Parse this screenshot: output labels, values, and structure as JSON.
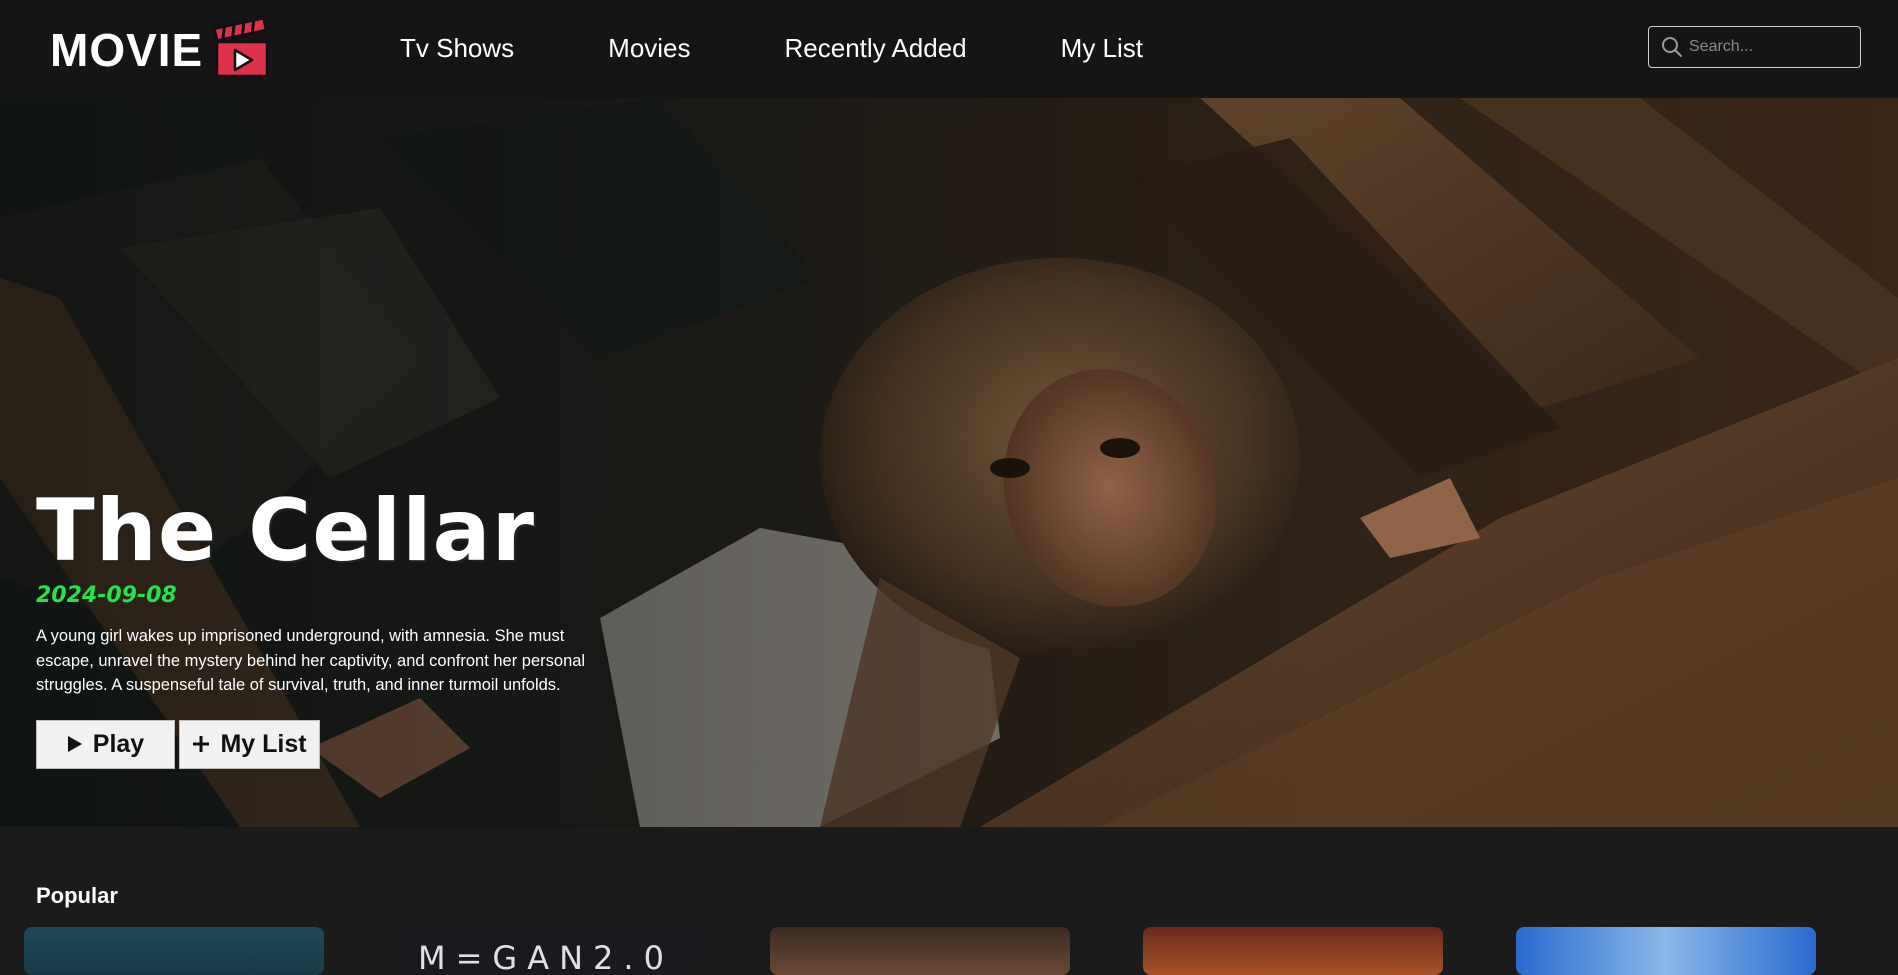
{
  "header": {
    "logo_text": "MOVIE",
    "nav": [
      "Tv Shows",
      "Movies",
      "Recently Added",
      "My List"
    ],
    "search_placeholder": "Search..."
  },
  "hero": {
    "title": "The Cellar",
    "date": "2024-09-08",
    "description": "A young girl wakes up imprisoned underground, with amnesia. She must escape, unravel the mystery behind her captivity, and confront her personal struggles. A suspenseful tale of survival, truth, and inner turmoil unfolds.",
    "play_label": "Play",
    "mylist_label": "My List"
  },
  "popular": {
    "title": "Popular",
    "cards": [
      {
        "label": ""
      },
      {
        "label": "M=GAN2.0"
      },
      {
        "label": ""
      },
      {
        "label": ""
      },
      {
        "label": ""
      }
    ]
  },
  "colors": {
    "accent_date": "#24e34a",
    "logo_clapper": "#e0314b",
    "background": "#1b1b1b"
  }
}
